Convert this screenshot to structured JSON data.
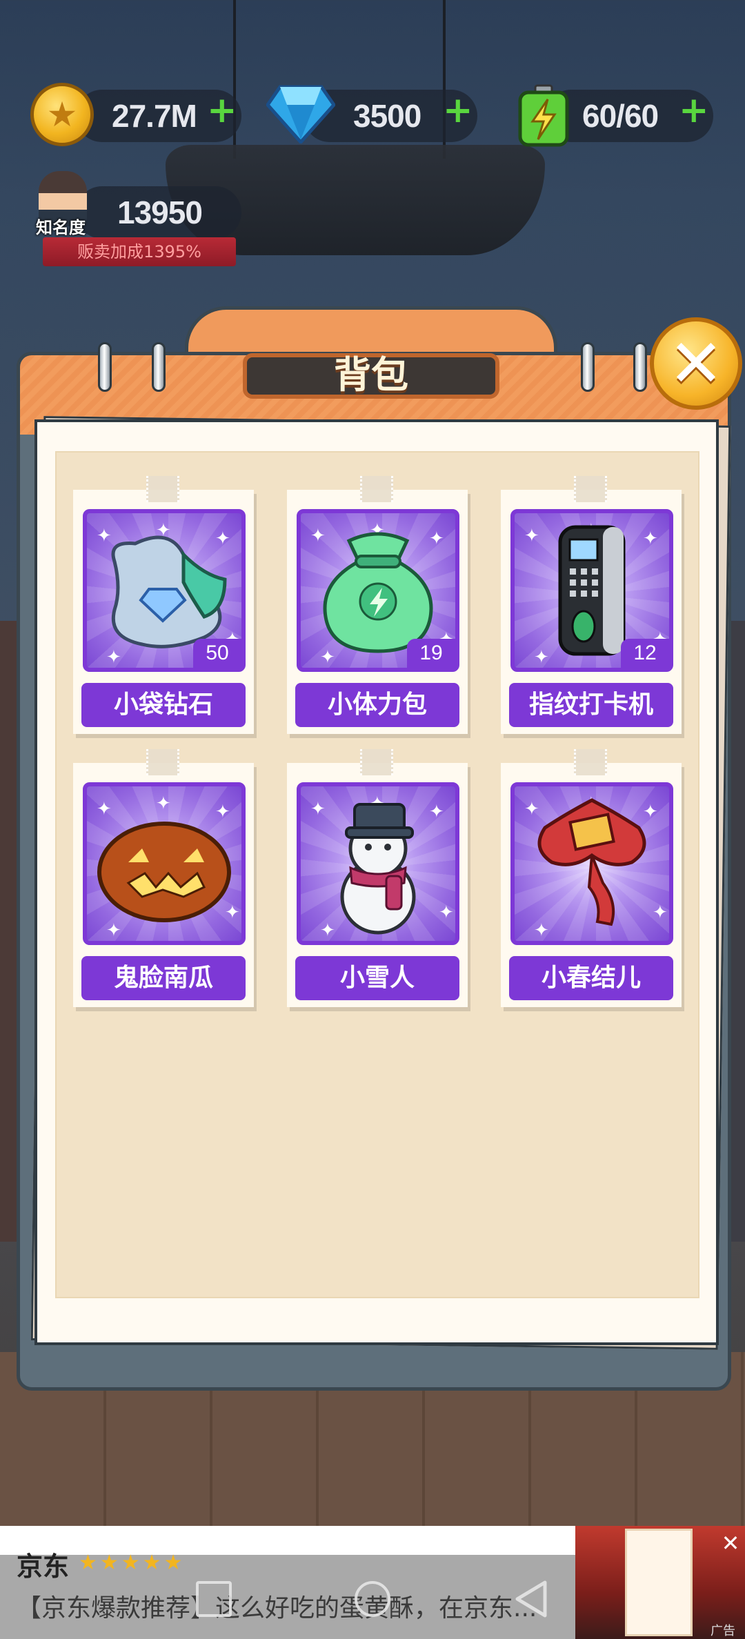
{
  "hud": {
    "coins": "27.7M",
    "gems": "3500",
    "energy": "60/60",
    "fame_label": "知名度",
    "fame_value": "13950",
    "fame_bonus": "贩卖加成1395%"
  },
  "panel": {
    "title": "背包"
  },
  "items": [
    {
      "name": "小袋钻石",
      "count": "50",
      "icon": "diamond-bag-icon"
    },
    {
      "name": "小体力包",
      "count": "19",
      "icon": "energy-bag-icon"
    },
    {
      "name": "指纹打卡机",
      "count": "12",
      "icon": "fingerprint-machine-icon"
    },
    {
      "name": "鬼脸南瓜",
      "count": "",
      "icon": "jack-o-lantern-icon"
    },
    {
      "name": "小雪人",
      "count": "",
      "icon": "snowman-icon"
    },
    {
      "name": "小春结儿",
      "count": "",
      "icon": "chinese-knot-icon"
    }
  ],
  "ad": {
    "brand": "京东",
    "rating_stars": 5,
    "text": "【京东爆款推荐】这么好吃的蛋黄酥，在京东...",
    "tag": "广告"
  },
  "colors": {
    "item_purple": "#7d38d6",
    "panel_orange": "#f29c5d",
    "paper": "#f2e2c6",
    "plus_green": "#59d63f",
    "close_gold": "#f7b429"
  }
}
